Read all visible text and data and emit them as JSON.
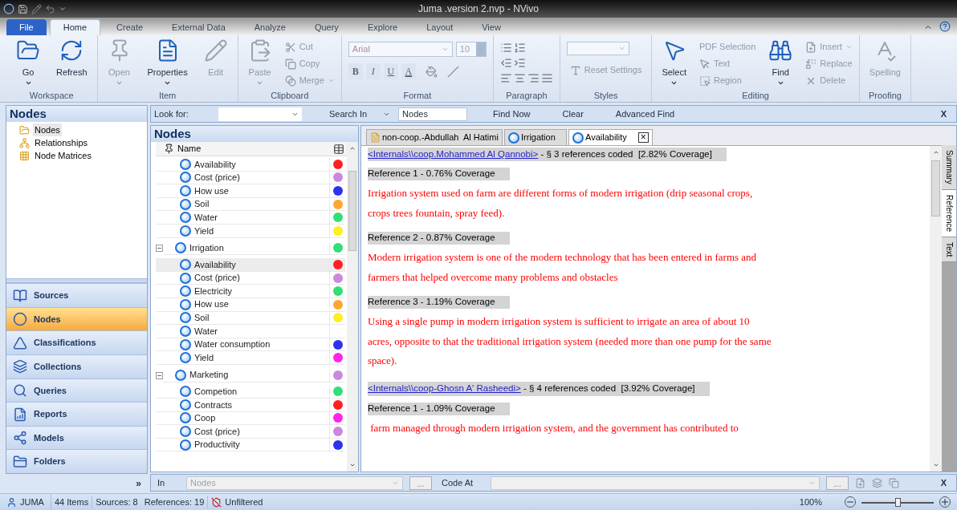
{
  "window": {
    "title": "Juma .version 2.nvp - NVivo"
  },
  "ribbon_tabs": [
    {
      "label": "File",
      "kind": "file",
      "selected": false
    },
    {
      "label": "Home",
      "kind": "tab",
      "selected": true
    },
    {
      "label": "Create",
      "kind": "tab",
      "selected": false
    },
    {
      "label": "External Data",
      "kind": "tab",
      "selected": false
    },
    {
      "label": "Analyze",
      "kind": "tab",
      "selected": false
    },
    {
      "label": "Query",
      "kind": "tab",
      "selected": false
    },
    {
      "label": "Explore",
      "kind": "tab",
      "selected": false
    },
    {
      "label": "Layout",
      "kind": "tab",
      "selected": false
    },
    {
      "label": "View",
      "kind": "tab",
      "selected": false
    }
  ],
  "ribbon_groups": [
    {
      "label": "Workspace",
      "kind": "buttons",
      "items": [
        {
          "label": "Go",
          "kind": "large",
          "dropdown": true,
          "disabled": false
        },
        {
          "label": "Refresh",
          "kind": "large",
          "dropdown": false,
          "disabled": false
        }
      ]
    },
    {
      "label": "Item",
      "kind": "buttons",
      "items": [
        {
          "label": "Open",
          "kind": "large",
          "dropdown": true,
          "disabled": true
        },
        {
          "label": "Properties",
          "kind": "large",
          "dropdown": true,
          "disabled": false
        },
        {
          "label": "Edit",
          "kind": "large",
          "dropdown": false,
          "disabled": true
        }
      ]
    },
    {
      "label": "Clipboard",
      "kind": "buttons",
      "items": [
        {
          "label": "Paste",
          "kind": "large",
          "dropdown": true,
          "disabled": true
        },
        {
          "label": "Cut",
          "kind": "small",
          "dropdown": false,
          "disabled": true
        },
        {
          "label": "Copy",
          "kind": "small",
          "dropdown": false,
          "disabled": true
        },
        {
          "label": "Merge",
          "kind": "small",
          "dropdown": true,
          "disabled": true
        }
      ]
    },
    {
      "label": "Format",
      "kind": "format",
      "font": "Arial",
      "font_size": "10",
      "format_buttons": [
        "B",
        "I",
        "U",
        "A"
      ]
    },
    {
      "label": "Paragraph",
      "kind": "paragraph"
    },
    {
      "label": "Styles",
      "kind": "styles",
      "items": [
        {
          "label": "Reset Settings",
          "kind": "small",
          "dropdown": false,
          "disabled": true
        }
      ]
    },
    {
      "label": "Editing",
      "kind": "buttons",
      "items": [
        {
          "label": "Select",
          "kind": "large",
          "dropdown": true,
          "disabled": false
        },
        {
          "label": "PDF Selection",
          "kind": "small",
          "dropdown": false,
          "disabled": true
        },
        {
          "label": "Text",
          "kind": "small",
          "dropdown": false,
          "disabled": true
        },
        {
          "label": "Region",
          "kind": "small",
          "dropdown": false,
          "disabled": true
        },
        {
          "label": "Find",
          "kind": "large",
          "dropdown": true,
          "disabled": false
        },
        {
          "label": "Insert",
          "kind": "small",
          "dropdown": true,
          "disabled": true
        },
        {
          "label": "Replace",
          "kind": "small",
          "dropdown": false,
          "disabled": true
        },
        {
          "label": "Delete",
          "kind": "small",
          "dropdown": false,
          "disabled": true
        }
      ]
    },
    {
      "label": "Proofing",
      "kind": "buttons",
      "items": [
        {
          "label": "Spelling",
          "kind": "large",
          "dropdown": false,
          "disabled": true
        }
      ]
    }
  ],
  "navigation": {
    "title": "Nodes",
    "tree": [
      {
        "label": "Nodes",
        "selected": true
      },
      {
        "label": "Relationships",
        "selected": false
      },
      {
        "label": "Node Matrices",
        "selected": false
      }
    ],
    "buttons": [
      {
        "label": "Sources",
        "selected": false
      },
      {
        "label": "Nodes",
        "selected": true
      },
      {
        "label": "Classifications",
        "selected": false
      },
      {
        "label": "Collections",
        "selected": false
      },
      {
        "label": "Queries",
        "selected": false
      },
      {
        "label": "Reports",
        "selected": false
      },
      {
        "label": "Models",
        "selected": false
      },
      {
        "label": "Folders",
        "selected": false
      }
    ],
    "expand_button": "»"
  },
  "find_bar": {
    "look_for_label": "Look for:",
    "search_in_label": "Search In",
    "search_in_value": "Nodes",
    "find_now": "Find Now",
    "clear": "Clear",
    "advanced_find": "Advanced Find",
    "close": "X"
  },
  "node_list": {
    "title": "Nodes",
    "column": "Name",
    "leading_children": [
      {
        "name": "Availability",
        "color": "#ff2020",
        "selected": false
      },
      {
        "name": "Cost (price)",
        "color": "#cc88dd",
        "selected": false
      },
      {
        "name": "How use",
        "color": "#3030f0",
        "selected": false
      },
      {
        "name": "Soil",
        "color": "#ffa530",
        "selected": false
      },
      {
        "name": "Water",
        "color": "#33dd77",
        "selected": false
      },
      {
        "name": "Yield",
        "color": "#ffee22",
        "selected": false
      }
    ],
    "nodes": [
      {
        "name": "Irrigation",
        "color": "#33dd77",
        "expanded": true,
        "children": [
          {
            "name": "Availability",
            "color": "#ff2020",
            "selected": true
          },
          {
            "name": "Cost (price)",
            "color": "#cc88dd",
            "selected": false
          },
          {
            "name": "Electricity",
            "color": "#33dd77",
            "selected": false
          },
          {
            "name": "How use",
            "color": "#ffa530",
            "selected": false
          },
          {
            "name": "Soil",
            "color": "#ffee22",
            "selected": false
          },
          {
            "name": "Water",
            "selected": false
          },
          {
            "name": "Water consumption",
            "color": "#3030f0",
            "selected": false
          },
          {
            "name": "Yield",
            "color": "#ff22ee",
            "selected": false
          }
        ]
      },
      {
        "name": "Marketing",
        "color": "#cc88dd",
        "expanded": true,
        "children": [
          {
            "name": "Competion",
            "color": "#33dd77",
            "selected": false
          },
          {
            "name": "Contracts",
            "color": "#ff2020",
            "selected": false
          },
          {
            "name": "Coop",
            "color": "#ff22ee",
            "selected": false
          },
          {
            "name": "Cost (price)",
            "color": "#cc88dd",
            "selected": false
          },
          {
            "name": "Productivity",
            "color": "#3030f0",
            "selected": false
          }
        ]
      }
    ]
  },
  "detail": {
    "tabs": [
      {
        "label": "non-coop.-Abdullah  Al Hatimi",
        "kind": "document",
        "selected": false,
        "closable": false
      },
      {
        "label": "Irrigation",
        "kind": "node",
        "selected": false,
        "closable": false
      },
      {
        "label": "Availability",
        "kind": "node",
        "selected": true,
        "closable": true
      }
    ],
    "close_glyph": "×",
    "blocks": [
      {
        "kind": "source",
        "link": "<Internals\\\\coop.Mohammed Al Qannobi>",
        "text": " - § 3 references coded  [2.82% Coverage]"
      },
      {
        "kind": "reference",
        "text": "Reference 1 - 0.76% Coverage"
      },
      {
        "kind": "quote",
        "text": "Irrigation system used on farm are different forms of modern irrigation (drip seasonal crops, crops trees fountain, spray feed)."
      },
      {
        "kind": "reference",
        "text": "Reference 2 - 0.87% Coverage"
      },
      {
        "kind": "quote",
        "text": "Modern irrigation system is one of the modern technology that has been entered in farms and farmers that helped overcome many problems and obstacles"
      },
      {
        "kind": "reference",
        "text": "Reference 3 - 1.19% Coverage"
      },
      {
        "kind": "quote",
        "text": "Using a single pump in modern irrigation system is sufficient to irrigate an area of about 10 acres, opposite to that the traditional irrigation system (needed more than one pump for the same space)."
      },
      {
        "kind": "source",
        "link": "<Internals\\\\coop-Ghosn A' Rasheedi>",
        "text": " - § 4 references coded  [3.92% Coverage]"
      },
      {
        "kind": "reference",
        "text": "Reference 1 - 1.09% Coverage"
      },
      {
        "kind": "quote",
        "text": " farm managed through modern irrigation system, and the government has contributed to"
      }
    ],
    "side_tabs": [
      {
        "label": "Summary",
        "selected": false
      },
      {
        "label": "Reference",
        "selected": true
      },
      {
        "label": "Text",
        "selected": false
      }
    ]
  },
  "code_bar": {
    "in_label": "In",
    "in_value": "Nodes",
    "browse": "...",
    "code_at_label": "Code At",
    "browse_2": "...",
    "close": "X"
  },
  "status_bar": {
    "user": "JUMA",
    "items": "44 Items",
    "sources": "Sources: 8",
    "references": "References: 19",
    "filter": "Unfiltered",
    "zoom": "100%",
    "zoom_slider": {
      "level": 0.5
    }
  }
}
